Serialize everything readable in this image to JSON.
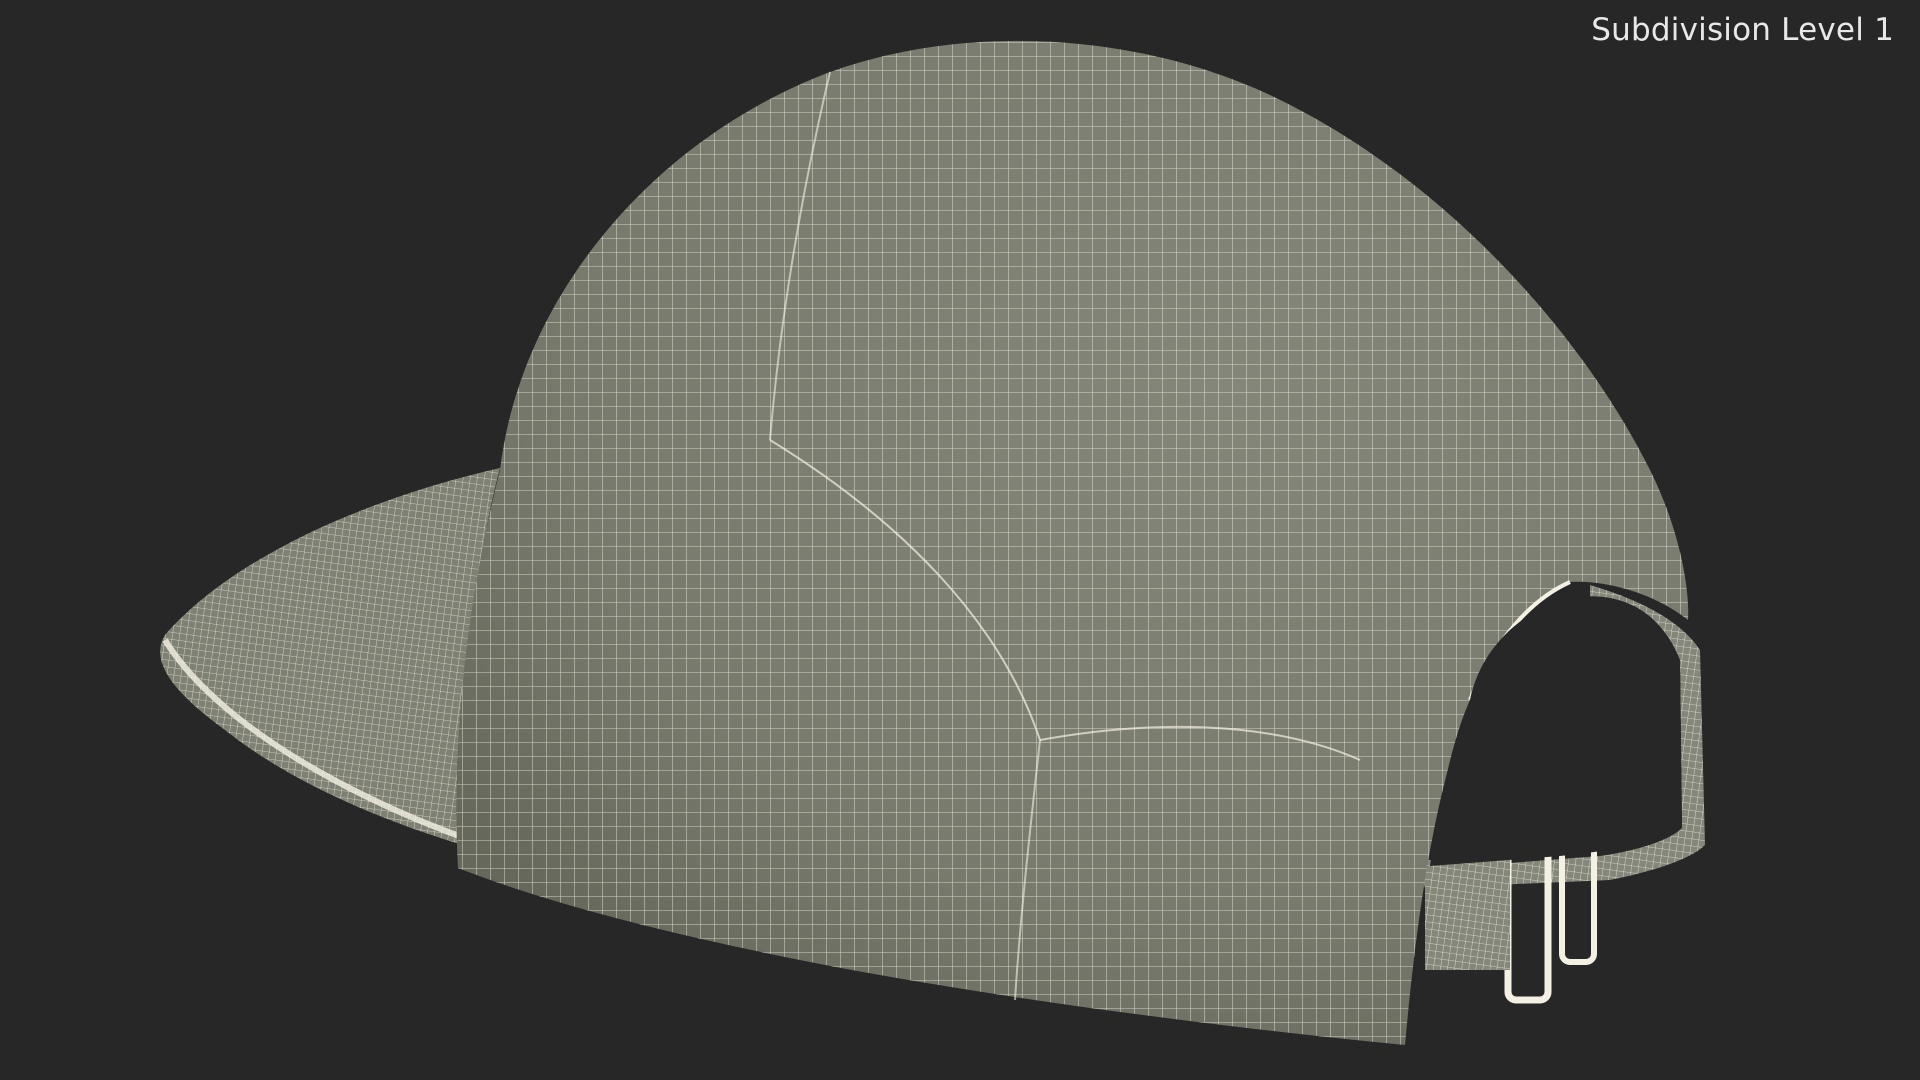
{
  "overlay": {
    "subdivision_label": "Subdivision Level 1"
  },
  "scene": {
    "object": "cap-wireframe",
    "background_color": "#272727",
    "surface_color": "#7b7d70",
    "surface_shadow_color": "#6b6d61",
    "wire_color": "#f4f1e4"
  }
}
